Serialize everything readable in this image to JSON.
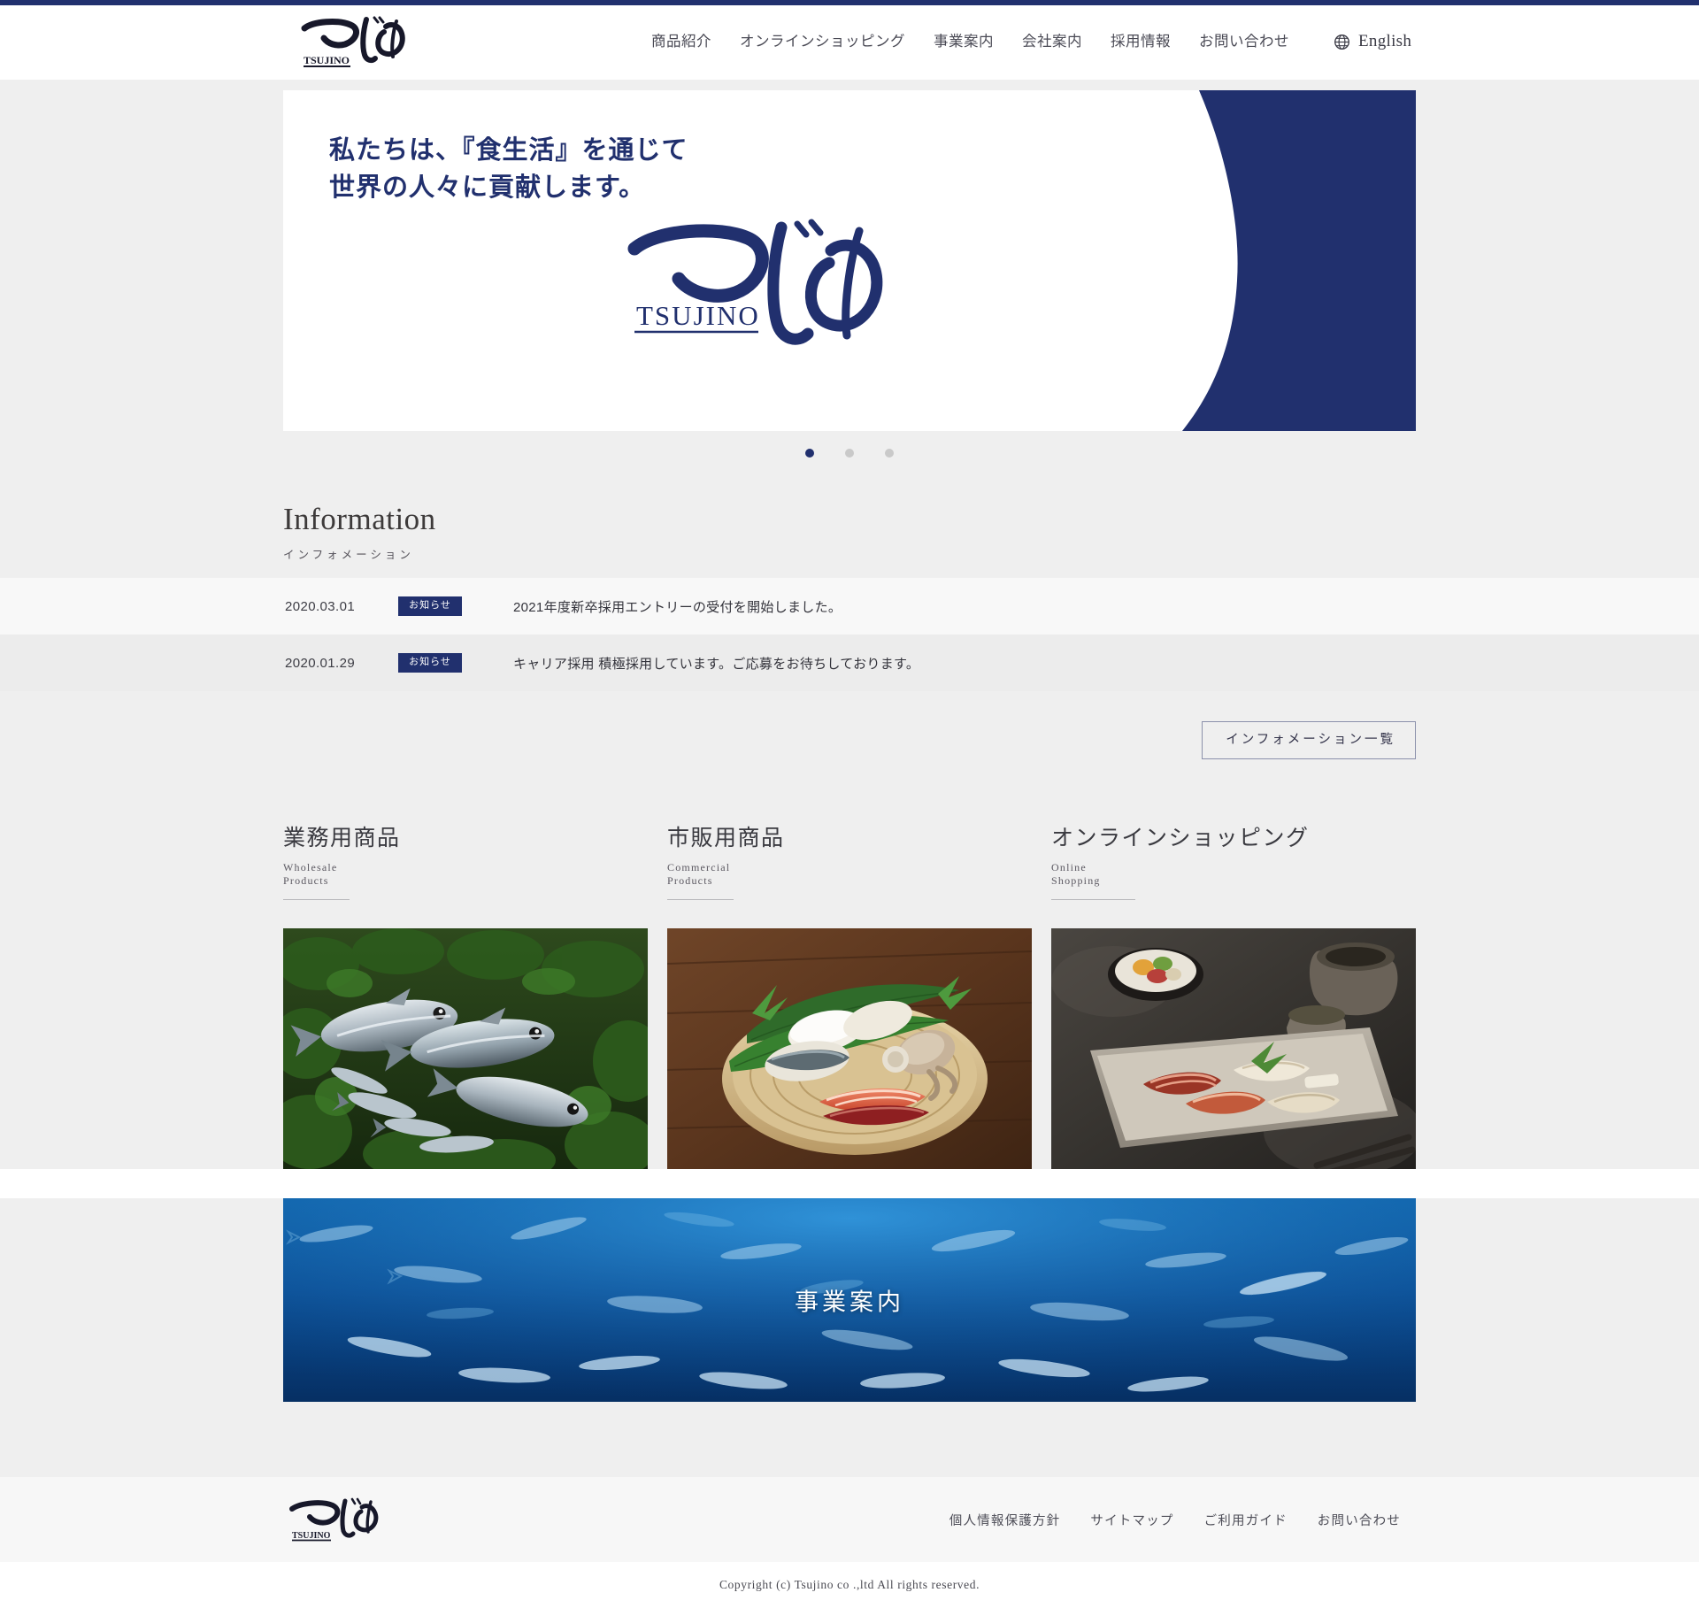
{
  "site": {
    "logo_alt": "つじの TSUJINO",
    "brand_name": "TSUJINO",
    "brand_kana": "つじの",
    "accent_color": "#21306e",
    "page_bg": "#efefef"
  },
  "header": {
    "nav": [
      {
        "label": "商品紹介",
        "name": "nav-products"
      },
      {
        "label": "オンラインショッピング",
        "name": "nav-online-shopping"
      },
      {
        "label": "事業案内",
        "name": "nav-business"
      },
      {
        "label": "会社案内",
        "name": "nav-company"
      },
      {
        "label": "採用情報",
        "name": "nav-recruit"
      },
      {
        "label": "お問い合わせ",
        "name": "nav-contact"
      }
    ],
    "language": {
      "label": "English",
      "icon": "globe-icon"
    }
  },
  "hero": {
    "copy_line1": "私たちは、『食生活』を通じて",
    "copy_line2": "世界の人々に貢献します。",
    "logo_kana": "つじの",
    "logo_roman": "TSUJINO",
    "slides_total": 3,
    "active_slide": 1
  },
  "information": {
    "title": "Information",
    "subtitle": "インフォメーション",
    "items": [
      {
        "date": "2020.03.01",
        "tag": "お知らせ",
        "text": "2021年度新卒採用エントリーの受付を開始しました。"
      },
      {
        "date": "2020.01.29",
        "tag": "お知らせ",
        "text": "キャリア採用 積極採用しています。ご応募をお待ちしております。"
      }
    ],
    "more_button": "インフォメーション一覧"
  },
  "categories": [
    {
      "jp": "業務用商品",
      "en": "Wholesale Products",
      "image_alt": "生鮮魚介の盛り合わせ"
    },
    {
      "jp": "市販用商品",
      "en": "Commercial Products",
      "image_alt": "切り身・加工品の盛り付け"
    },
    {
      "jp": "オンラインショッピング",
      "en": "Online Shopping",
      "image_alt": "西京漬けの盛り付け"
    }
  ],
  "business_banner": {
    "label": "事業案内",
    "image_alt": "青い海を泳ぐ魚の群れ"
  },
  "footer": {
    "links": [
      "個人情報保護方針",
      "サイトマップ",
      "ご利用ガイド",
      "お問い合わせ"
    ],
    "copyright": "Copyright (c) Tsujino co .,ltd All rights reserved."
  }
}
